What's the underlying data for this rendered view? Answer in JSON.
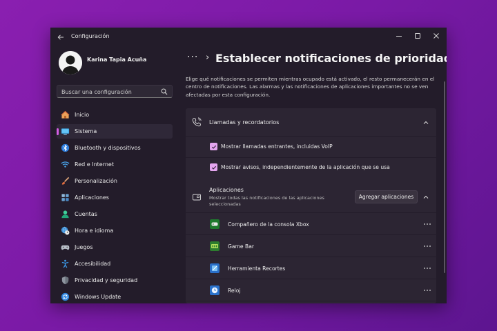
{
  "window": {
    "title": "Configuración"
  },
  "profile": {
    "name": "Karina Tapia Acuña"
  },
  "search": {
    "placeholder": "Buscar una configuración"
  },
  "sidebar": {
    "items": [
      {
        "label": "Inicio",
        "icon": "home-icon"
      },
      {
        "label": "Sistema",
        "icon": "system-icon",
        "selected": true
      },
      {
        "label": "Bluetooth y dispositivos",
        "icon": "bluetooth-icon"
      },
      {
        "label": "Red e Internet",
        "icon": "wifi-icon"
      },
      {
        "label": "Personalización",
        "icon": "brush-icon"
      },
      {
        "label": "Aplicaciones",
        "icon": "apps-icon"
      },
      {
        "label": "Cuentas",
        "icon": "account-icon"
      },
      {
        "label": "Hora e idioma",
        "icon": "globe-clock-icon"
      },
      {
        "label": "Juegos",
        "icon": "gamepad-icon"
      },
      {
        "label": "Accesibilidad",
        "icon": "accessibility-icon"
      },
      {
        "label": "Privacidad y seguridad",
        "icon": "shield-icon"
      },
      {
        "label": "Windows Update",
        "icon": "update-icon"
      }
    ]
  },
  "main": {
    "title": "Establecer notificaciones de prioridad",
    "description": "Elige qué notificaciones se permiten mientras ocupado está activado, el resto permanecerán en el centro de notificaciones. Las alarmas y las notificaciones de aplicaciones importantes no se ven afectadas por esta configuración.",
    "calls": {
      "title": "Llamadas y recordatorios",
      "options": [
        {
          "label": "Mostrar llamadas entrantes, incluidas VoIP",
          "checked": true
        },
        {
          "label": "Mostrar avisos, independientemente de la aplicación que se usa",
          "checked": true
        }
      ]
    },
    "apps": {
      "title": "Aplicaciones",
      "subtitle": "Mostrar todas las notificaciones de las aplicaciones seleccionadas",
      "add_label": "Agregar aplicaciones",
      "list": [
        {
          "label": "Compañero de la consola Xbox",
          "icon": "xbox-companion-icon"
        },
        {
          "label": "Game Bar",
          "icon": "game-bar-icon"
        },
        {
          "label": "Herramienta Recortes",
          "icon": "snipping-tool-icon"
        },
        {
          "label": "Reloj",
          "icon": "clock-icon"
        }
      ]
    }
  },
  "colors": {
    "accent": "#d55fe6",
    "checkbox": "#e5a6f0",
    "window_bg": "#231c2a",
    "card_bg": "#2c2533"
  }
}
